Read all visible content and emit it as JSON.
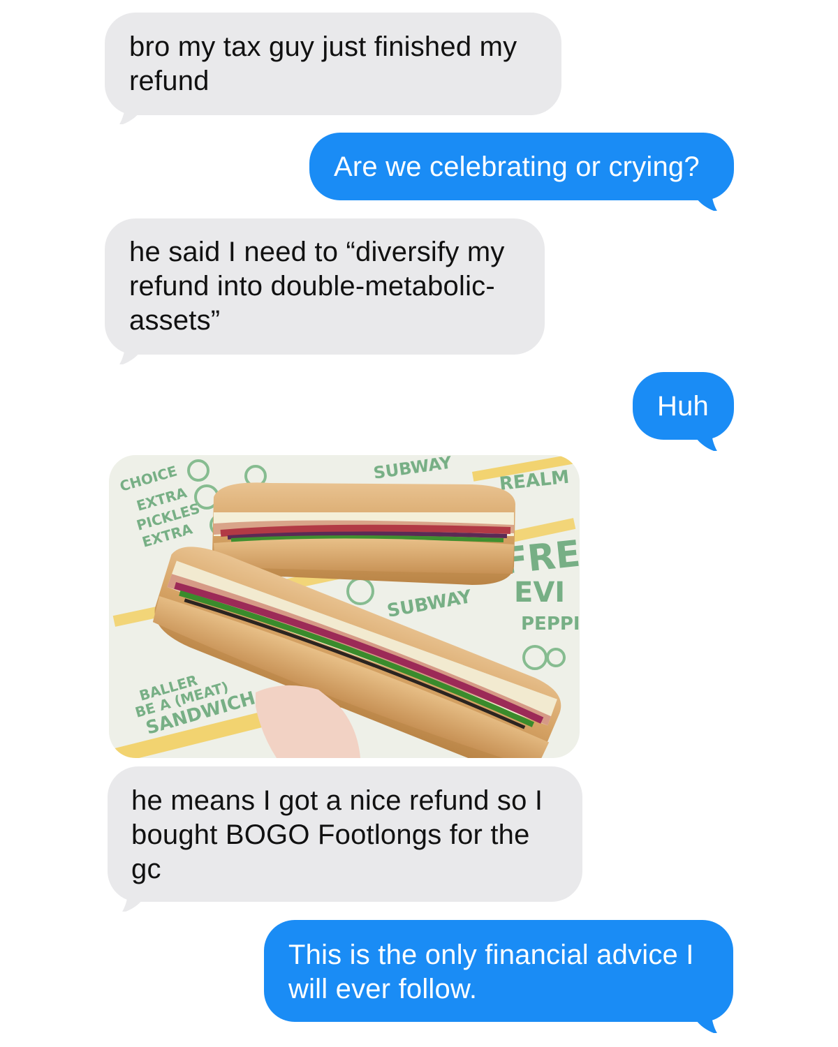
{
  "conversation": {
    "messages": [
      {
        "sender": "them",
        "text": "bro my tax guy just finished my\nrefund"
      },
      {
        "sender": "me",
        "text": "Are we celebrating or crying?"
      },
      {
        "sender": "them",
        "text": "he said I need to “diversify my\nrefund into double-metabolic-\nassets”"
      },
      {
        "sender": "me",
        "text": "Huh"
      },
      {
        "sender": "them",
        "type": "image",
        "description": "photo-sandwiches-on-subway-wrapper"
      },
      {
        "sender": "them",
        "text": "he means I got a nice refund so I\nbought BOGO Footlongs for the\ngc"
      },
      {
        "sender": "me",
        "text": "This is the only financial advice I\nwill ever follow."
      }
    ]
  },
  "colors": {
    "incoming_bubble": "#e9e9eb",
    "outgoing_bubble": "#1a8cf5",
    "incoming_text": "#111111",
    "outgoing_text": "#ffffff"
  },
  "photo": {
    "wrapper_text": [
      "CHOICE",
      "EXTRA",
      "PICKLES",
      "EXTRA",
      "SANDWICH",
      "SUBWAY",
      "FRE",
      "PEPPI",
      "REALM",
      "SUBWAY",
      "BE A (MEAT)",
      "BALLER",
      "EVI"
    ]
  }
}
